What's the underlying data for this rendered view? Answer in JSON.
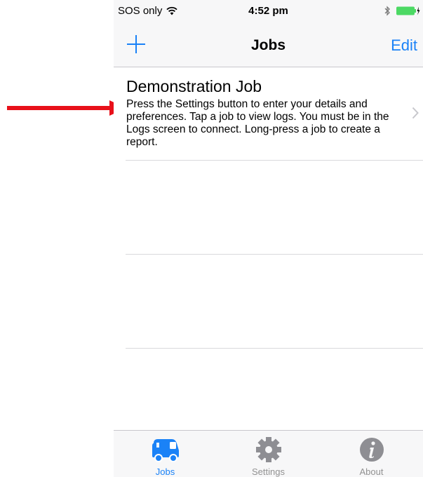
{
  "status_bar": {
    "carrier": "SOS only",
    "time": "4:52 pm"
  },
  "nav": {
    "title": "Jobs",
    "edit_label": "Edit"
  },
  "jobs": [
    {
      "title": "Demonstration Job",
      "description": "Press the Settings button to enter your details and preferences. Tap a job to view logs. You must be in the Logs screen to connect. Long-press a job to create a report."
    }
  ],
  "tabs": [
    {
      "label": "Jobs",
      "icon": "van-icon",
      "active": true
    },
    {
      "label": "Settings",
      "icon": "gear-icon",
      "active": false
    },
    {
      "label": "About",
      "icon": "info-icon",
      "active": false
    }
  ],
  "colors": {
    "accent": "#1a82f7",
    "annotation": "#e8101a",
    "battery": "#4cd964",
    "inactive_tab": "#929292"
  }
}
